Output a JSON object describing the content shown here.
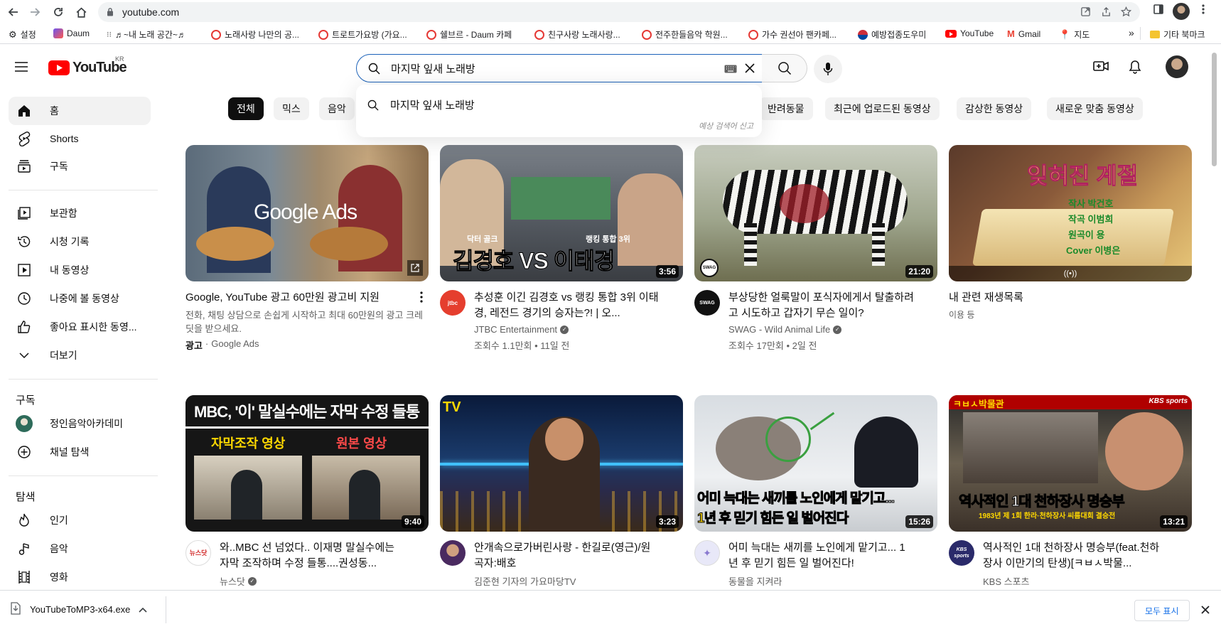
{
  "browser": {
    "url": "youtube.com",
    "bookmarks": [
      {
        "label": "설정",
        "color": "#444444"
      },
      {
        "label": "Daum",
        "color": "#6b56f0"
      },
      {
        "label": "♬~내 노래 공간~♬",
        "color": "#555555"
      },
      {
        "label": "노래사랑 나만의 공...",
        "color": "#e53935"
      },
      {
        "label": "트로트가요방 (가요...",
        "color": "#e53935"
      },
      {
        "label": "쉘브르 - Daum 카페",
        "color": "#e53935"
      },
      {
        "label": "친구사랑 노래사랑...",
        "color": "#e53935"
      },
      {
        "label": "전주한들음악 학원...",
        "color": "#e53935"
      },
      {
        "label": "가수 권선아 팬카페...",
        "color": "#e53935"
      },
      {
        "label": "예방접종도우미",
        "color": "#1a237e"
      },
      {
        "label": "YouTube",
        "color": "#ff0000"
      },
      {
        "label": "Gmail",
        "color": "#ea4335"
      },
      {
        "label": "지도",
        "color": "#34a853"
      }
    ],
    "more_bookmarks": "»",
    "other_bookmarks": "기타 북마크"
  },
  "header": {
    "logo_text": "YouTube",
    "region": "KR",
    "search_value": "마지막 잎새 노래방"
  },
  "suggestion": {
    "text": "마지막 잎새 노래방",
    "report": "예상 검색어 신고"
  },
  "chips": [
    "전체",
    "믹스",
    "음악",
    "반려동물",
    "최근에 업로드된 동영상",
    "감상한 동영상",
    "새로운 맞춤 동영상"
  ],
  "sidebar": {
    "main": [
      "홈",
      "Shorts",
      "구독"
    ],
    "library": [
      "보관함",
      "시청 기록",
      "내 동영상",
      "나중에 볼 동영상",
      "좋아요 표시한 동영...",
      "더보기"
    ],
    "subs_heading": "구독",
    "subs": [
      "정인음악아카데미",
      "채널 탐색"
    ],
    "explore_heading": "탐색",
    "explore": [
      "인기",
      "음악",
      "영화"
    ]
  },
  "videos": [
    {
      "title": "Google, YouTube 광고 60만원 광고비 지원",
      "desc": "전화, 채팅 상담으로 손쉽게 시작하고 최대 60만원의 광고 크레딧을 받으세요.",
      "ad_label": "광고",
      "channel": "Google Ads",
      "overlay": "Google Ads"
    },
    {
      "title": "추성훈 이긴 김경호 vs 랭킹 통합 3위 이태경, 레전드 경기의 승자는?! | 오...",
      "channel": "JTBC Entertainment",
      "stats": "조회수 1.1만회 • 11일 전",
      "duration": "3:56",
      "overlay": "김경호 VS 이태경",
      "overlay_top_left": "닥터 골크",
      "overlay_top_right": "랭킹 통합 3위",
      "avatar": "jtbc"
    },
    {
      "title": "부상당한 얼룩말이 포식자에게서 탈출하려고 시도하고 갑자기 무슨 일이?",
      "channel": "SWAG - Wild Animal Life",
      "stats": "조회수 17만회 • 2일 전",
      "duration": "21:20",
      "avatar": "SWAG"
    },
    {
      "title": "내 관련 재생목록",
      "sub": "이용 등",
      "overlay": "잊혀진 계절",
      "overlay_lines": [
        "작사 박건호",
        "작곡 이범희",
        "원곡이 용",
        "Cover 이병은"
      ]
    },
    {
      "title": "와..MBC 선 넘었다.. 이재명 말실수에는 자막 조작하며 수정 들통....권성동...",
      "channel": "뉴스닷",
      "duration": "9:40",
      "overlay": "MBC, '이' 말실수에는 자막 수정 들통",
      "overlay_left": "자막조작 영상",
      "overlay_right": "원본 영상",
      "avatar": "뉴스닷"
    },
    {
      "title": "안개속으로가버린사랑 - 한길로(영근)/원곡자:배호",
      "channel": "김준현 기자의 가요마당TV",
      "duration": "3:23",
      "overlay": "TV"
    },
    {
      "title": "어미 늑대는 새끼를 노인에게 맡기고... 1년 후 믿기 힘든 일 벌어진다!",
      "channel": "동물을 지켜라",
      "duration": "15:26",
      "overlay": "어미 늑대는 새끼를 노인에게 맡기고...",
      "overlay2": "1년 후 믿기 힘든 일 벌어진다"
    },
    {
      "title": "역사적인 1대 천하장사 명승부(feat.천하장사 이만기의 탄생)[ㅋㅂㅅ박물...",
      "channel": "KBS 스포츠",
      "duration": "13:21",
      "overlay": "역사적인 1대 천하장사 명승부",
      "overlay_sub": "1983년 제 1회 한라·천하장사 씨름대회 결승전",
      "overlay_badge": "ㅋㅂㅅ박물관",
      "overlay_brand": "KBS sports",
      "avatar": "KBS sports"
    }
  ],
  "download": {
    "file": "YouTubeToMP3-x64.exe",
    "show_all": "모두 표시"
  },
  "colors": {
    "yt_red": "#ff0000",
    "chip_bg": "#f2f2f2",
    "chip_active": "#0f0f0f",
    "search_border": "#1c62b9",
    "link_blue": "#1a73e8"
  }
}
